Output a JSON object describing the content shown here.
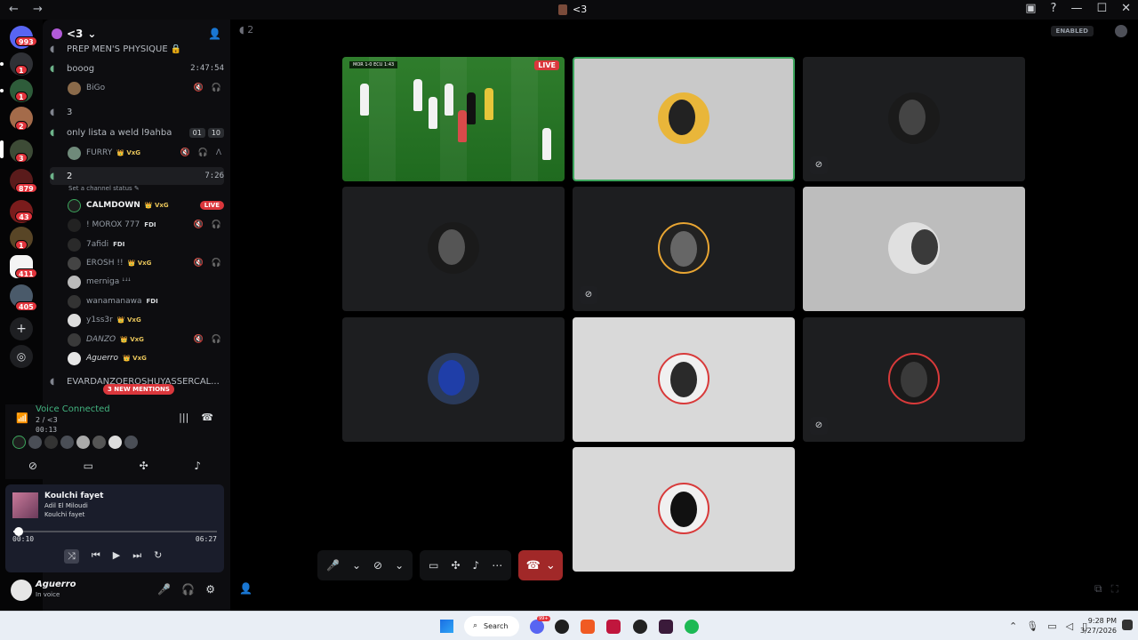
{
  "window": {
    "title": "<3",
    "nav": "← →",
    "controls": [
      "▣",
      "?",
      "—",
      "☐",
      "✕"
    ]
  },
  "guilds": {
    "badges": [
      "993",
      "1",
      "1",
      "2",
      "3",
      "879",
      "43",
      "1",
      "411",
      "405"
    ],
    "add_icon": "+",
    "discover_icon": "◎"
  },
  "server": {
    "name": "<3",
    "invite_icon": "person-add"
  },
  "channels": [
    {
      "name": "PREP MEN'S PHYSIQUE 🔒",
      "time": "",
      "muted": true
    },
    {
      "name": "booog",
      "time": "2:47:54"
    },
    {
      "name": "3",
      "time": "",
      "grey": true
    },
    {
      "name": "only lista a weld l9ahba",
      "boxes": [
        "01",
        "10"
      ]
    },
    {
      "name": "2",
      "time": "7:26",
      "selected": true
    },
    {
      "name": "EVARDANZOEROSHUYASSERCAL...",
      "grey": true
    }
  ],
  "channel_users": {
    "booog": [
      {
        "name": "BiGo",
        "tag": "",
        "right": "🔇 🎧"
      }
    ],
    "lista": [
      {
        "name": "FURRY",
        "tag": "👑 VxG",
        "right": "🔇 🎧 Λ"
      }
    ]
  },
  "set_status": "Set a channel status ✎",
  "voice_users": [
    {
      "name": "CALMDOWN",
      "tag": "👑 VxG",
      "right": "LIVE",
      "live": true
    },
    {
      "name": "! MOROX 777",
      "tag": "FDI",
      "fdi": true,
      "right": "🔇 🎧"
    },
    {
      "name": "7afidi",
      "tag": "FDI",
      "fdi": true,
      "right": ""
    },
    {
      "name": "EROSH !!",
      "tag": "👑 VxG",
      "right": "🔇 🎧"
    },
    {
      "name": "merniga ꜜꜜꜜ",
      "tag": "",
      "right": ""
    },
    {
      "name": "wanamanawa",
      "tag": "FDI",
      "fdi": true,
      "right": ""
    },
    {
      "name": "y1ss3r",
      "tag": "👑 VxG",
      "right": ""
    },
    {
      "name": "DANZO",
      "tag": "👑 VxG",
      "right": "🔇 🎧"
    },
    {
      "name": "Aguerro",
      "tag": "👑 VxG",
      "right": ""
    }
  ],
  "mentions": "3 NEW MENTIONS",
  "voice_connected": {
    "title": "Voice Connected",
    "channel": "2 / <3",
    "elapsed": "00:13",
    "controls": [
      "|||",
      "☎"
    ],
    "actions": [
      "camera-off",
      "screen-share",
      "activities",
      "soundboard"
    ]
  },
  "music": {
    "song": "Koulchi fayet",
    "artist": "Adil El Miloudi",
    "album": "Koulchi fayet",
    "current": "00:10",
    "total": "06:27",
    "progress": 0.026,
    "controls": [
      "⤨",
      "⏮",
      "▶",
      "⏭",
      "↻"
    ]
  },
  "me": {
    "name": "Aguerro",
    "status": "In voice",
    "controls": [
      "🎤",
      "🎧",
      "⚙"
    ]
  },
  "stage": {
    "channel_label": "2",
    "enabled_badge": "ENABLED",
    "live_label": "LIVE",
    "score": "MOR 1-0 ECU 1:43"
  },
  "taskbar": {
    "search": "Search",
    "time": "9:28 PM",
    "date": "3/27/2026",
    "discord_badge": "99+"
  }
}
